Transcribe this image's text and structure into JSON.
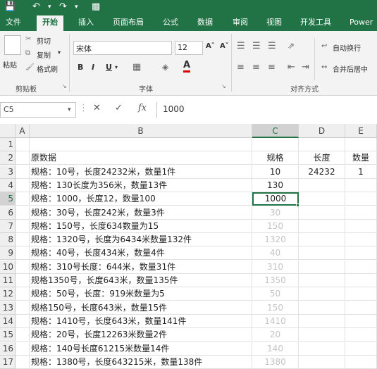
{
  "ribbon_tabs": [
    "文件",
    "开始",
    "插入",
    "页面布局",
    "公式",
    "数据",
    "审阅",
    "视图",
    "开发工具",
    "Power"
  ],
  "clipboard": {
    "cut": "剪切",
    "copy": "复制",
    "format_painter": "格式刷",
    "paste": "粘贴",
    "group": "剪贴板"
  },
  "font": {
    "name": "宋体",
    "size": "12",
    "bold": "B",
    "italic": "I",
    "underline": "U",
    "group": "字体"
  },
  "alignment": {
    "wrap": "自动换行",
    "merge": "合并后居中",
    "group": "对齐方式"
  },
  "formula_bar": {
    "name_box": "C5",
    "value": "1000",
    "fx": "fx"
  },
  "columns": [
    "A",
    "B",
    "C",
    "D",
    "E"
  ],
  "rows": [
    {
      "num": "1",
      "b": "",
      "c": "",
      "d": "",
      "e": ""
    },
    {
      "num": "2",
      "b": "原数据",
      "c": "规格",
      "d": "长度",
      "e": "数量"
    },
    {
      "num": "3",
      "b": "规格：10号，长度24232米，数量1件",
      "c": "10",
      "d": "24232",
      "e": "1"
    },
    {
      "num": "4",
      "b": "规格：130长度为356米，数量13件",
      "c": "130",
      "d": "",
      "e": ""
    },
    {
      "num": "5",
      "b": "规格：1000，长度12，数量100",
      "c": "1000",
      "d": "",
      "e": ""
    },
    {
      "num": "6",
      "b": "规格：30号，长度242米，数量3件",
      "c": "30",
      "d": "",
      "e": ""
    },
    {
      "num": "7",
      "b": "规格：150号，长度634数量为15",
      "c": "150",
      "d": "",
      "e": ""
    },
    {
      "num": "8",
      "b": "规格：1320号，长度为6434米数量132件",
      "c": "1320",
      "d": "",
      "e": ""
    },
    {
      "num": "9",
      "b": "规格：40号，长度434米，数量4件",
      "c": "40",
      "d": "",
      "e": ""
    },
    {
      "num": "10",
      "b": "规格：310号长度：644米，数量31件",
      "c": "310",
      "d": "",
      "e": ""
    },
    {
      "num": "11",
      "b": "规格1350号，长度643米，数量135件",
      "c": "1350",
      "d": "",
      "e": ""
    },
    {
      "num": "12",
      "b": "规格：50号，长度：919米数量为5",
      "c": "50",
      "d": "",
      "e": ""
    },
    {
      "num": "13",
      "b": "规格150号，长度643米，数量15件",
      "c": "150",
      "d": "",
      "e": ""
    },
    {
      "num": "14",
      "b": "规格：1410号，长度643米，数量141件",
      "c": "1410",
      "d": "",
      "e": ""
    },
    {
      "num": "15",
      "b": "规格：20号，长度12263米数量2件",
      "c": "20",
      "d": "",
      "e": ""
    },
    {
      "num": "16",
      "b": "规格：140号长度61215米数量14件",
      "c": "140",
      "d": "",
      "e": ""
    },
    {
      "num": "17",
      "b": "规格：1380号，长度643215米，数量138件",
      "c": "1380",
      "d": "",
      "e": ""
    }
  ]
}
